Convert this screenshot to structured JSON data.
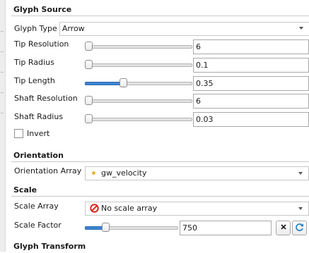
{
  "glyph_source": {
    "header": "Glyph Source",
    "glyph_type_label": "Glyph Type",
    "glyph_type_value": "Arrow",
    "tip_resolution": {
      "label": "Tip Resolution",
      "value": "6",
      "slider_fraction": 0.0
    },
    "tip_radius": {
      "label": "Tip Radius",
      "value": "0.1",
      "slider_fraction": 0.0
    },
    "tip_length": {
      "label": "Tip Length",
      "value": "0.35",
      "slider_fraction": 0.35
    },
    "shaft_resolution": {
      "label": "Shaft Resolution",
      "value": "6",
      "slider_fraction": 0.0
    },
    "shaft_radius": {
      "label": "Shaft Radius",
      "value": "0.03",
      "slider_fraction": 0.0
    },
    "invert_label": "Invert",
    "invert_checked": false
  },
  "orientation": {
    "header": "Orientation",
    "array_label": "Orientation Array",
    "array_value": "gw_velocity"
  },
  "scale": {
    "header": "Scale",
    "array_label": "Scale Array",
    "array_value": "No scale array",
    "factor_label": "Scale Factor",
    "factor_value": "750",
    "factor_slider_fraction": 0.2
  },
  "glyph_transform": {
    "header": "Glyph Transform"
  },
  "colors": {
    "slider_fill": "#3e84d0",
    "no_icon": "#d9261c",
    "reset_icon": "#2f86c9",
    "orientation_dot": "#e8b640"
  }
}
